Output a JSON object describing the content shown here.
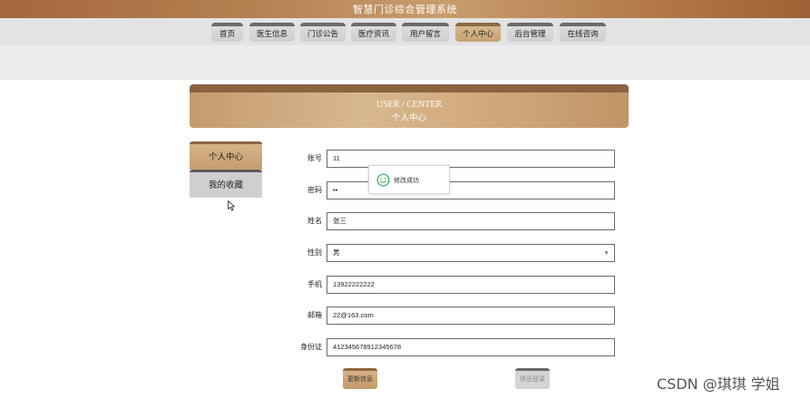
{
  "header": {
    "title": "智慧门诊综合管理系统"
  },
  "nav": {
    "items": [
      {
        "label": "首页"
      },
      {
        "label": "医生信息"
      },
      {
        "label": "门诊公告"
      },
      {
        "label": "医疗资讯"
      },
      {
        "label": "用户留言"
      },
      {
        "label": "个人中心",
        "active": true
      },
      {
        "label": "后台管理"
      },
      {
        "label": "在线咨询"
      }
    ]
  },
  "banner": {
    "title_en": "USER / CENTER",
    "title_cn": "个人中心"
  },
  "sidebar": {
    "items": [
      {
        "label": "个人中心",
        "active": true
      },
      {
        "label": "我的收藏"
      }
    ]
  },
  "form": {
    "account": {
      "label": "账号",
      "value": "11"
    },
    "password": {
      "label": "密码",
      "value": "••"
    },
    "name": {
      "label": "姓名",
      "value": "张三"
    },
    "gender": {
      "label": "性别",
      "value": "男"
    },
    "phone": {
      "label": "手机",
      "value": "13922222222"
    },
    "email": {
      "label": "邮箱",
      "value": "22@163.com"
    },
    "id_card": {
      "label": "身份证",
      "value": "412345678912345678"
    }
  },
  "buttons": {
    "update": "更新信息",
    "logout": "退出登录"
  },
  "toast": {
    "message": "修改成功",
    "icon": "smile-icon"
  },
  "watermark": "CSDN @琪琪 学姐",
  "colors": {
    "brand": "#a3683a",
    "accent": "#c8a273",
    "toast_icon": "#3db865"
  }
}
